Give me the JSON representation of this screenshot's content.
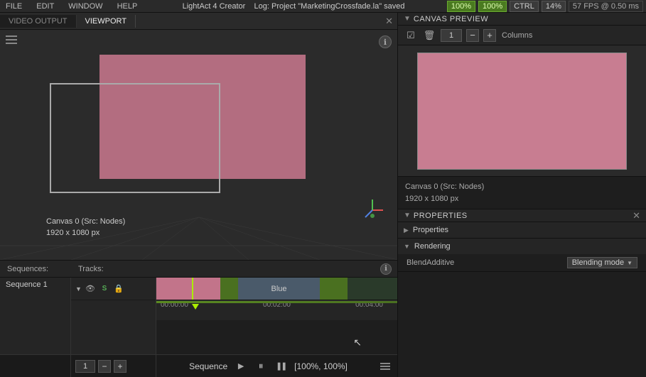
{
  "menubar": {
    "items": [
      "FILE",
      "EDIT",
      "WINDOW",
      "HELP"
    ],
    "app_title": "LightAct 4 Creator",
    "log_message": "Log: Project \"MarketingCrossfade.la\" saved",
    "metrics": {
      "zoom1": "100%",
      "zoom2": "100%",
      "ctrl": "CTRL",
      "cpu": "14%",
      "fps": "57 FPS @ 0.50 ms"
    }
  },
  "viewport": {
    "tab_video_output": "VIDEO OUTPUT",
    "tab_viewport": "VIEWPORT",
    "canvas_label": "Canvas 0 (Src: Nodes)",
    "canvas_size": "1920 x 1080 px"
  },
  "canvas_preview": {
    "title": "CANVAS PREVIEW",
    "canvas_label": "Canvas 0 (Src: Nodes)",
    "canvas_size": "1920 x 1080 px",
    "column_value": "1",
    "columns_label": "Columns"
  },
  "sequence": {
    "sequences_label": "Sequences:",
    "tracks_label": "Tracks:",
    "sequence_name": "Sequence 1",
    "track_blue_label": "Blue",
    "playback_label": "Sequence",
    "playback_status": "[100%, 100%]",
    "frame_number": "1",
    "timecodes": {
      "start": "00:00:00",
      "mid1": "00:02:00",
      "mid2": "00:04:00"
    }
  },
  "properties": {
    "title": "PROPERTIES",
    "section_properties": "Properties",
    "section_rendering": "Rendering",
    "blend_key": "BlendAdditive",
    "blend_value": "Blending mode"
  },
  "icons": {
    "info": "ℹ",
    "hamburger": "≡",
    "close": "✕",
    "play": "▶",
    "pause": "⏸",
    "pause_alt": "❚❚",
    "pipe": "⏸",
    "arrow_down": "▼",
    "arrow_right": "▶",
    "eye": "👁",
    "s_letter": "S",
    "lock": "🔒",
    "checkbox": "☑",
    "trash": "🗑",
    "minus": "−",
    "plus": "+"
  },
  "colors": {
    "pink_canvas": "#c2748a",
    "green_accent": "#aaee00",
    "track_green": "#4a7020",
    "track_blue_bg": "#4a5a6a",
    "bg_dark": "#1e1e1e",
    "bg_medium": "#252525",
    "bg_light": "#2a2a2a"
  }
}
